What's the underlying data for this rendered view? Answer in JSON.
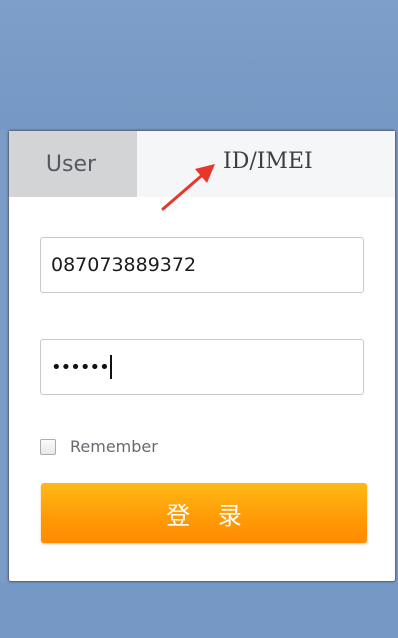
{
  "tabs": {
    "user_label": "User",
    "imei_label": "ID/IMEI"
  },
  "form": {
    "username_value": "087073889372",
    "password_masked": "••••••",
    "remember_label": "Remember",
    "remember_checked": false,
    "login_label": "登 录"
  },
  "colors": {
    "background": "#7a9cc6",
    "login_button": "#ffa00a",
    "arrow": "#e8362b"
  },
  "annotation": {
    "icon": "red-arrow-icon"
  }
}
